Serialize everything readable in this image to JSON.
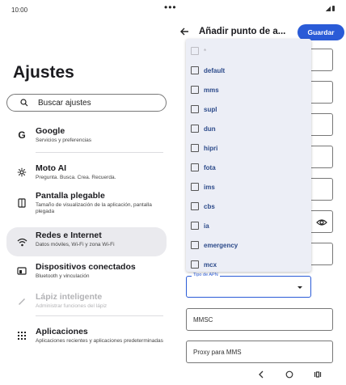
{
  "status": {
    "time": "10:00",
    "dots": "•••"
  },
  "left": {
    "title": "Ajustes",
    "search_placeholder": "Buscar ajustes",
    "items": [
      {
        "title": "Google",
        "sub": "Servicios y preferencias",
        "icon": "google-icon"
      },
      {
        "title": "Moto AI",
        "sub": "Pregunta. Busca. Crea. Recuerda.",
        "icon": "moto-ai-icon"
      },
      {
        "title": "Pantalla plegable",
        "sub": "Tamaño de visualización de la aplicación, pantalla plegada",
        "icon": "foldable-display-icon"
      },
      {
        "title": "Redes e Internet",
        "sub": "Datos móviles, Wi-Fi y zona Wi-Fi",
        "icon": "wifi-icon"
      },
      {
        "title": "Dispositivos conectados",
        "sub": "Bluetooth y vinculación",
        "icon": "connected-devices-icon"
      },
      {
        "title": "Lápiz inteligente",
        "sub": "Administrar funciones del lápiz",
        "icon": "stylus-icon"
      },
      {
        "title": "Aplicaciones",
        "sub": "Aplicaciones recientes y aplicaciones predeterminadas",
        "icon": "apps-grid-icon"
      }
    ]
  },
  "right": {
    "title": "Añadir punto de a...",
    "save_label": "Guardar",
    "apn_type_label": "Tipo de APN",
    "mmsc_label": "MMSC",
    "mms_proxy_label": "Proxy para MMS",
    "dropdown_options": [
      "*",
      "default",
      "mms",
      "supl",
      "dun",
      "hipri",
      "fota",
      "ims",
      "cbs",
      "ia",
      "emergency",
      "mcx"
    ]
  }
}
